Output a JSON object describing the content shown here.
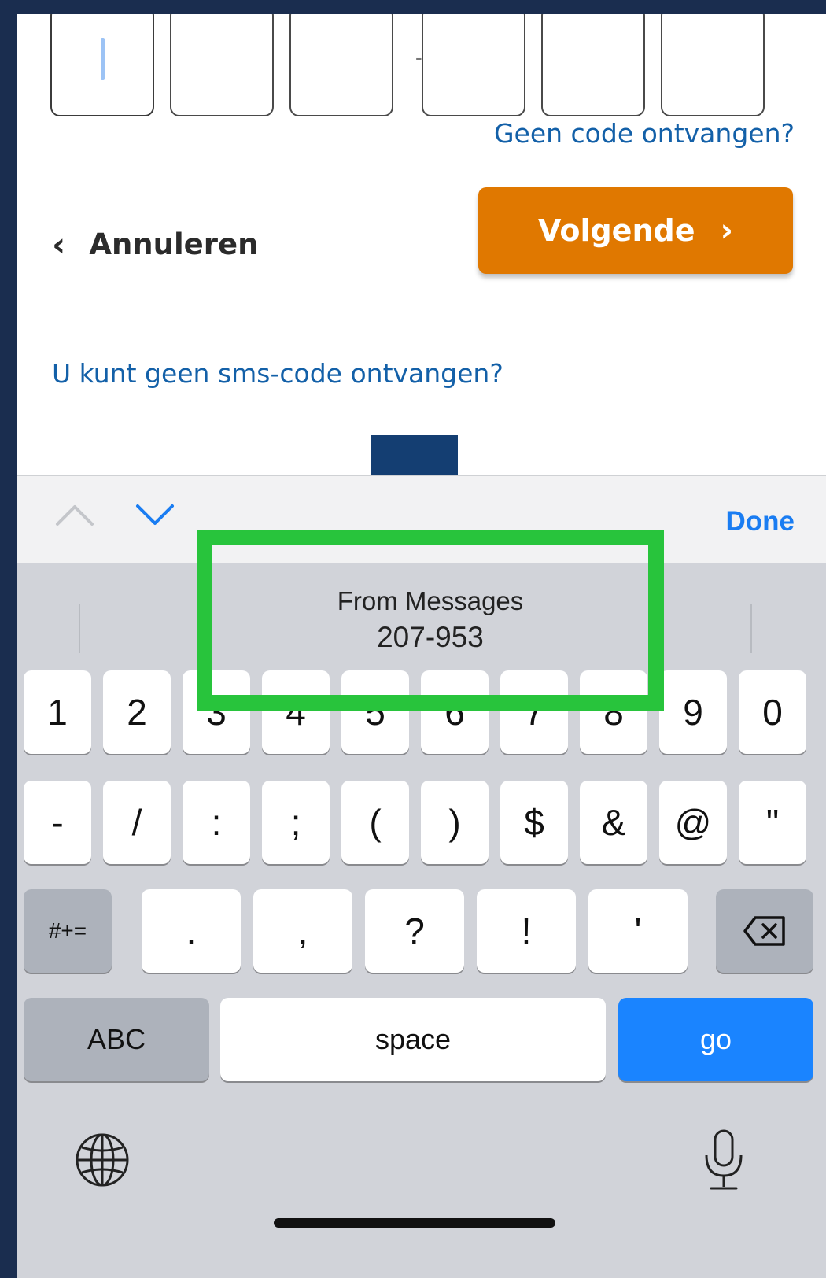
{
  "form": {
    "code_boxes": [
      "",
      "",
      "",
      "",
      "",
      ""
    ],
    "separator": "-",
    "no_code_link": "Geen code ontvangen?",
    "cancel_label": "Annuleren",
    "next_label": "Volgende",
    "no_sms_link": "U kunt geen sms-code ontvangen?"
  },
  "toolbar": {
    "prev_icon": "chevron-up-icon",
    "next_icon": "chevron-down-icon",
    "done_label": "Done"
  },
  "suggestion": {
    "source": "From Messages",
    "code": "207-953"
  },
  "keyboard": {
    "row1": [
      "1",
      "2",
      "3",
      "4",
      "5",
      "6",
      "7",
      "8",
      "9",
      "0"
    ],
    "row2": [
      "-",
      "/",
      ":",
      ";",
      "(",
      ")",
      "$",
      "&",
      "@",
      "\""
    ],
    "row3": [
      "#+=",
      ".",
      ",",
      "?",
      "!",
      "'"
    ],
    "abc_label": "ABC",
    "space_label": "space",
    "go_label": "go"
  },
  "colors": {
    "next_button": "#e07800",
    "link": "#1360a8",
    "highlight": "#28c43c",
    "go_key": "#1a84ff"
  }
}
